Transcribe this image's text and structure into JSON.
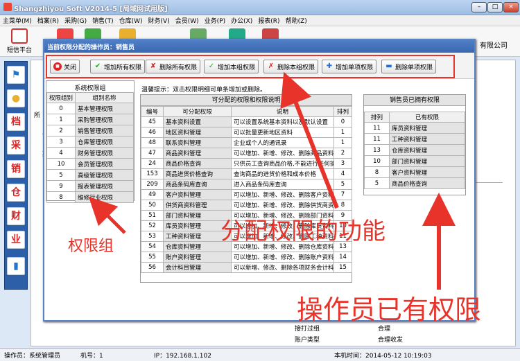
{
  "window": {
    "title": "Shangzhiyou Soft V2014-5 [局域网试用版]"
  },
  "menu": [
    "主菜单(M)",
    "档案(R)",
    "采购(G)",
    "销售(T)",
    "仓库(W)",
    "财务(V)",
    "会员(W)",
    "业务(P)",
    "办公(X)",
    "报表(R)",
    "帮助(Z)"
  ],
  "toolbar": {
    "sms": "短信平台"
  },
  "company": "有限公司",
  "main_bg": {
    "row_label": "所",
    "row_values": [
      "上",
      "1",
      "期"
    ],
    "bottom_left": "接打过组",
    "bottom_right": "合理",
    "bottom_left2": "账户类型",
    "bottom_right2": "合理收发"
  },
  "status": {
    "operator": "操作员：系统管理员",
    "machine": "机号：1",
    "ip": "IP：192.168.1.102",
    "time": "本机时间：2014-05-12 10:19:03"
  },
  "dialog": {
    "title": "当前权限分配的操作员：销售员",
    "buttons": {
      "close": "关闭",
      "add_all": "增加所有权限",
      "delete_all": "删除所有权限",
      "add_group": "增加本组权限",
      "delete_group": "删除本组权限",
      "add_single": "增加单项权限",
      "delete_single": "删除单项权限"
    },
    "tip": "温馨提示：双击权限明细可单条增加或删除。",
    "groups": {
      "title": "系统权限组",
      "headers": [
        "权限组别",
        "组别名称"
      ],
      "rows": [
        [
          "0",
          "基本管理权限"
        ],
        [
          "1",
          "采购管理权限"
        ],
        [
          "2",
          "销售管理权限"
        ],
        [
          "3",
          "仓库管理权限"
        ],
        [
          "4",
          "财务管理权限"
        ],
        [
          "10",
          "会员管理权限"
        ],
        [
          "5",
          "高级管理权限"
        ],
        [
          "9",
          "报表管理权限"
        ],
        [
          "8",
          "维修行业权限"
        ]
      ]
    },
    "assignable": {
      "title": "可分配的权限和权限说明",
      "headers": [
        "编号",
        "可分配权限",
        "说明",
        "排列"
      ],
      "rows": [
        [
          "45",
          "基本资料设置",
          "可以设置系统基本资料以及默认设置",
          "0"
        ],
        [
          "46",
          "地区资料管理",
          "可以批量更新地区资料",
          "1"
        ],
        [
          "48",
          "联系资料管理",
          "企业或个人的通讯录",
          "1"
        ],
        [
          "47",
          "商品资料管理",
          "可以增加、新增、修改、删除商品资料",
          "2"
        ],
        [
          "24",
          "商品价格查询",
          "只供员工查询商品价格,不能进行任何操作",
          "3"
        ],
        [
          "153",
          "商品进货价格查询",
          "查询商品的进货价格和成本价格",
          "4"
        ],
        [
          "209",
          "商品条码库查询",
          "进入商品条码库查询",
          "5"
        ],
        [
          "49",
          "客户资料管理",
          "可以增加、新增、修改、删除客户资料",
          "7"
        ],
        [
          "50",
          "供货商资料管理",
          "可以增加、新增、修改、删除供货商资料",
          "8"
        ],
        [
          "51",
          "部门资料管理",
          "可以增加、新增、修改、删除部门资料",
          "9"
        ],
        [
          "52",
          "库员资料管理",
          "可以增加、新增、修改、删除库员资料",
          "10"
        ],
        [
          "53",
          "工种资料管理",
          "可以增加、新增、修改、删除工种资料",
          "11"
        ],
        [
          "54",
          "仓库资料管理",
          "可以增加、新增、修改、删除仓库资料",
          "13"
        ],
        [
          "55",
          "账户资料管理",
          "可以增加、新增、修改、删除账户资料",
          "14"
        ],
        [
          "56",
          "会计科目管理",
          "可以新增、修改、删除各项财务会计科目",
          "15"
        ]
      ]
    },
    "owned": {
      "title": "销售员已拥有权限",
      "headers": [
        "排列",
        "已有权限"
      ],
      "rows": [
        [
          "11",
          "库员资料管理"
        ],
        [
          "11",
          "工种资料管理"
        ],
        [
          "13",
          "仓库资料管理"
        ],
        [
          "10",
          "部门资料管理"
        ],
        [
          "8",
          "客户资料管理"
        ],
        [
          "5",
          "商品价格查询"
        ]
      ]
    }
  },
  "annotations": {
    "group": "权限组",
    "assign": "分配权限的功能",
    "owned": "操作员已有权限"
  },
  "colors": {
    "annotation_red": "#e8332b",
    "dialog_title": "#3a68b0"
  }
}
